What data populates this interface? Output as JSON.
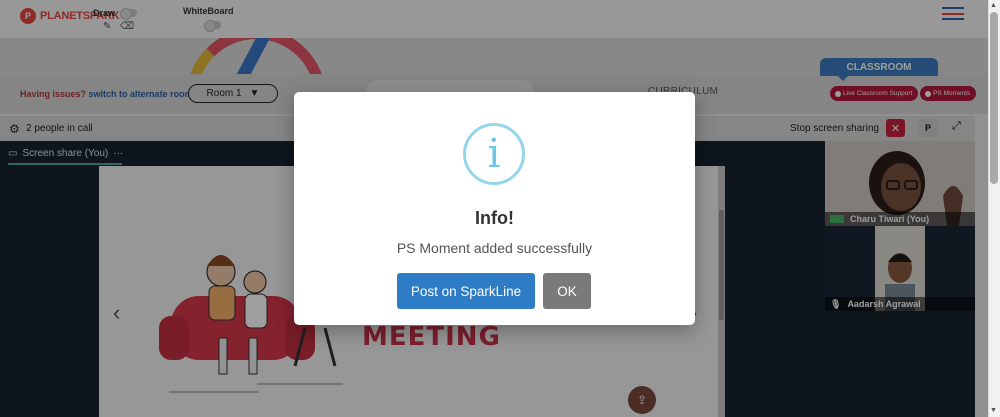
{
  "app": {
    "brand_text": "PLANETSPARK",
    "brand_badge": "P",
    "draw_label": "Draw",
    "whiteboard_label": "WhiteBoard"
  },
  "issue_bar": {
    "prefix": "Having issues?",
    "link": "switch to alternate room",
    "room_selected": "Room 1",
    "curriculum_label": "CURRICULUM"
  },
  "classroom": {
    "tab_label": "CLASSROOM",
    "support_button": "Live Classroom Support",
    "ps_moments_button": "PS Moments"
  },
  "call_bar": {
    "people_count_text": "2 people in call",
    "stop_sharing_label": "Stop screen sharing",
    "p_label": "P"
  },
  "screen_share": {
    "tab_label": "Screen share (You)",
    "more": "···",
    "slide_word": "MEETING"
  },
  "participants": [
    {
      "name": "Charu Tiwari (You)"
    },
    {
      "name": "Aadarsh Agrawal"
    }
  ],
  "modal": {
    "icon_glyph": "i",
    "title": "Info!",
    "message": "PS Moment added successfully",
    "primary_button": "Post on SparkLine",
    "secondary_button": "OK"
  },
  "colors": {
    "brand_red": "#e4473f",
    "primary_blue": "#2e7bc6",
    "info_ring": "#93d6ec",
    "ps_red": "#b3173d"
  }
}
